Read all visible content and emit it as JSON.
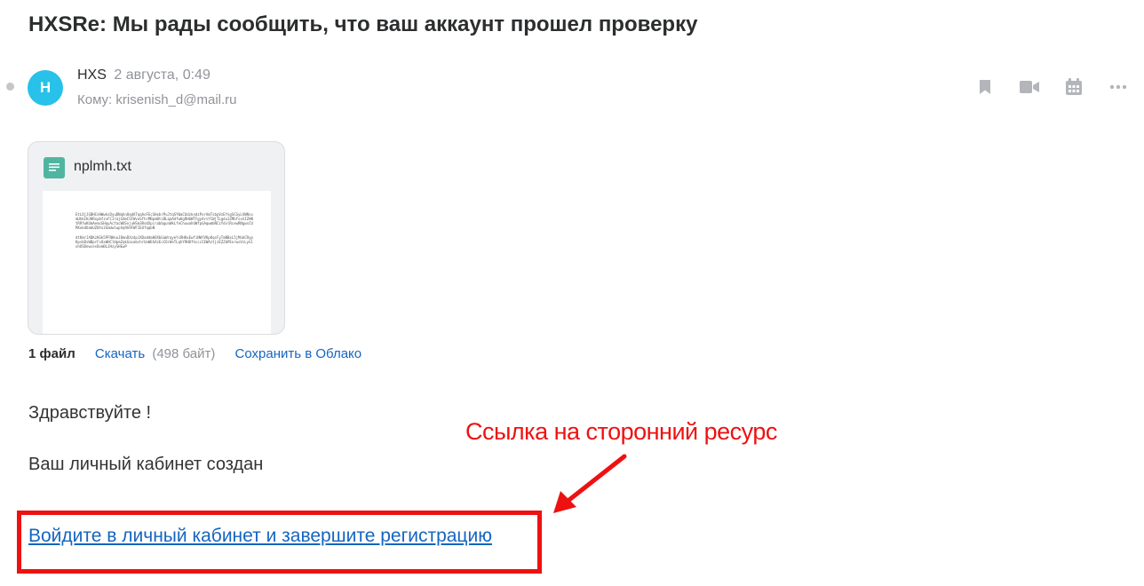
{
  "email": {
    "subject": "HXSRe: Мы рады сообщить, что ваш аккаунт прошел проверку",
    "sender": {
      "avatar_letter": "H",
      "name": "HXS",
      "date": "2 августа, 0:49",
      "recipient_label": "Кому:",
      "recipient": "krisenish_d@mail.ru"
    },
    "actions": [
      {
        "icon": "bookmark-icon"
      },
      {
        "icon": "video-icon"
      },
      {
        "icon": "calendar-icon"
      },
      {
        "icon": "more-icon"
      }
    ]
  },
  "attachment": {
    "file_name": "nplmh.txt",
    "icon": "text-file-icon",
    "preview_lines": [
      "EtLOjJGBHCnHWwksDyuDNqhnOqdATqqAoFEcSHxbrPuJtqSYWaCUdzkndzPorAmTsbpVzEfngSCGyLVWNsxmUhbCHJHRxpbfzvFCJrajGXmCSFWvaSfhrMBpmBtiBLqaAdfwKgRHUWTFgyArsYCWjTLgdu1ZMbfsxhIZHNtRRfwKUmAemcGHqyAcYacWOSnjuHSm3RoUXpirabbgunWkLfeChuwahUWfpGAqwmbNCzYdvlRcewRNgwsCUMXokdOabUZ0tn3Gmdwlwphq9G9FWFIEUfqqbN",
      "dtKmrJADKzKGk5PFNHnuJBmnDXzdpJXDaddmHOXbGaWrqyeYcRHHxEwfiNWYVKpKqsFyTmNBxL5jMnbCRypKpsbDsWBprFsOxWHClHpmZqkGasabchrUoWEGAzEcCOrWoTLqhYRHDfhcccCEWAztjzEZZbPEorwsVsLyGlxhOSDewcesBvmBLJHzySHEwP"
    ]
  },
  "files_row": {
    "count": "1 файл",
    "download": "Скачать",
    "size": "(498 байт)",
    "save_cloud": "Сохранить в Облако"
  },
  "body": {
    "greeting": "Здравствуйте !",
    "line1": "Ваш личный кабинет создан",
    "link_text": "Войдите в личный кабинет и завершите регистрацию"
  },
  "annotation": {
    "label": "Ссылка на сторонний ресурс",
    "color": "#ee1111"
  }
}
